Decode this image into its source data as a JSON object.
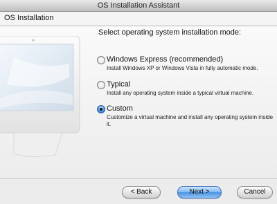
{
  "window": {
    "title": "OS Installation Assistant"
  },
  "header": {
    "title": "OS Installation"
  },
  "main": {
    "prompt": "Select operating system installation mode:",
    "options": [
      {
        "label": "Windows Express (recommended)",
        "description": "Install Windows XP or Windows Vista in fully automatic mode.",
        "selected": false
      },
      {
        "label": "Typical",
        "description": "Install any operating system inside a typical virtual machine.",
        "selected": false
      },
      {
        "label": "Custom",
        "description": "Customize a virtual machine and install any operating system inside it.",
        "selected": true
      }
    ]
  },
  "buttons": {
    "back": "< Back",
    "next": "Next >",
    "cancel": "Cancel"
  },
  "colors": {
    "accent": "#3a86e0",
    "default_button": "#5b9fe6"
  }
}
